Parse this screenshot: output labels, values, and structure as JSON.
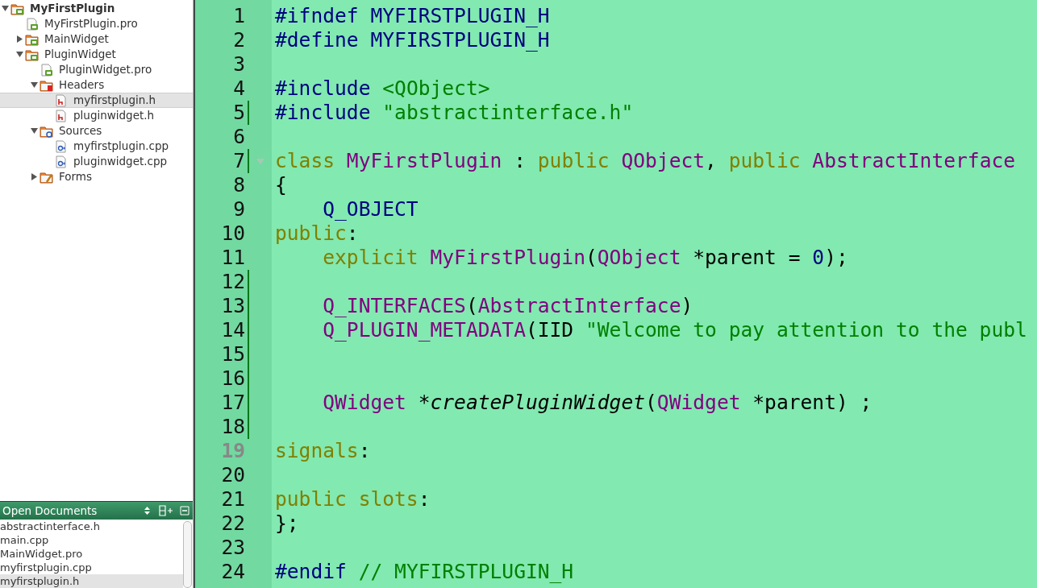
{
  "project_tree": [
    {
      "label": "MyFirstPlugin",
      "kind": "project",
      "expanded": true,
      "bold": true,
      "selected": false,
      "children": [
        {
          "label": "MyFirstPlugin.pro",
          "kind": "pro",
          "selected": false
        },
        {
          "label": "MainWidget",
          "kind": "project",
          "expanded": false,
          "selected": false
        },
        {
          "label": "PluginWidget",
          "kind": "project",
          "expanded": true,
          "selected": false,
          "children": [
            {
              "label": "PluginWidget.pro",
              "kind": "pro",
              "selected": false
            },
            {
              "label": "Headers",
              "kind": "headers",
              "expanded": true,
              "selected": false,
              "children": [
                {
                  "label": "myfirstplugin.h",
                  "kind": "header",
                  "selected": true
                },
                {
                  "label": "pluginwidget.h",
                  "kind": "header",
                  "selected": false
                }
              ]
            },
            {
              "label": "Sources",
              "kind": "sources",
              "expanded": true,
              "selected": false,
              "children": [
                {
                  "label": "myfirstplugin.cpp",
                  "kind": "source",
                  "selected": false
                },
                {
                  "label": "pluginwidget.cpp",
                  "kind": "source",
                  "selected": false
                }
              ]
            },
            {
              "label": "Forms",
              "kind": "forms",
              "expanded": false,
              "selected": false
            }
          ]
        }
      ]
    }
  ],
  "open_documents": {
    "title": "Open Documents",
    "items": [
      {
        "label": "abstractinterface.h",
        "selected": false
      },
      {
        "label": "main.cpp",
        "selected": false
      },
      {
        "label": "MainWidget.pro",
        "selected": false
      },
      {
        "label": "myfirstplugin.cpp",
        "selected": false
      },
      {
        "label": "myfirstplugin.h",
        "selected": true
      }
    ]
  },
  "editor": {
    "lines": [
      {
        "number": "1",
        "tokens": [
          {
            "kind": "preproc",
            "text": "#ifndef MYFIRSTPLUGIN_H"
          }
        ]
      },
      {
        "number": "2",
        "tokens": [
          {
            "kind": "preproc",
            "text": "#define MYFIRSTPLUGIN_H"
          }
        ]
      },
      {
        "number": "3"
      },
      {
        "number": "4",
        "tokens": [
          {
            "kind": "preproc",
            "text": "#include "
          },
          {
            "kind": "string",
            "text": "<QObject>"
          }
        ]
      },
      {
        "number": "5",
        "changed": true,
        "tokens": [
          {
            "kind": "preproc",
            "text": "#include "
          },
          {
            "kind": "string",
            "text": "\"abstractinterface.h\""
          }
        ]
      },
      {
        "number": "6"
      },
      {
        "number": "7",
        "changed": true,
        "foldable": true,
        "tokens": [
          {
            "kind": "keyword",
            "text": "class "
          },
          {
            "kind": "type",
            "text": "MyFirstPlugin"
          },
          {
            "kind": "plain",
            "text": " : "
          },
          {
            "kind": "keyword",
            "text": "public "
          },
          {
            "kind": "type",
            "text": "QObject"
          },
          {
            "kind": "plain",
            "text": ", "
          },
          {
            "kind": "keyword",
            "text": "public "
          },
          {
            "kind": "type",
            "text": "AbstractInterface"
          }
        ]
      },
      {
        "number": "8",
        "tokens": [
          {
            "kind": "plain",
            "text": "{"
          }
        ]
      },
      {
        "number": "9",
        "indented": true,
        "tokens": [
          {
            "kind": "preproc",
            "text": "Q_OBJECT"
          }
        ]
      },
      {
        "number": "10",
        "tokens": [
          {
            "kind": "keyword",
            "text": "public"
          },
          {
            "kind": "plain",
            "text": ":"
          }
        ]
      },
      {
        "number": "11",
        "indented": true,
        "tokens": [
          {
            "kind": "keyword",
            "text": "explicit "
          },
          {
            "kind": "type",
            "text": "MyFirstPlugin"
          },
          {
            "kind": "plain",
            "text": "("
          },
          {
            "kind": "type",
            "text": "QObject"
          },
          {
            "kind": "plain",
            "text": " *parent = "
          },
          {
            "kind": "number",
            "text": "0"
          },
          {
            "kind": "plain",
            "text": ");"
          }
        ]
      },
      {
        "number": "12",
        "changed": true
      },
      {
        "number": "13",
        "changed": true,
        "indented": true,
        "tokens": [
          {
            "kind": "type",
            "text": "Q_INTERFACES"
          },
          {
            "kind": "plain",
            "text": "("
          },
          {
            "kind": "type",
            "text": "AbstractInterface"
          },
          {
            "kind": "plain",
            "text": ")"
          }
        ]
      },
      {
        "number": "14",
        "changed": true,
        "indented": true,
        "tokens": [
          {
            "kind": "type",
            "text": "Q_PLUGIN_METADATA"
          },
          {
            "kind": "plain",
            "text": "(IID "
          },
          {
            "kind": "string",
            "text": "\"Welcome to pay attention to the publ"
          }
        ]
      },
      {
        "number": "15",
        "changed": true
      },
      {
        "number": "16",
        "changed": true
      },
      {
        "number": "17",
        "changed": true,
        "indented": true,
        "tokens": [
          {
            "kind": "type",
            "text": "QWidget"
          },
          {
            "kind": "plain",
            "text": " *"
          },
          {
            "kind": "function",
            "text": "createPluginWidget"
          },
          {
            "kind": "plain",
            "text": "("
          },
          {
            "kind": "type",
            "text": "QWidget"
          },
          {
            "kind": "plain",
            "text": " *parent) ;"
          }
        ]
      },
      {
        "number": "18",
        "changed": true
      },
      {
        "number": "19",
        "current": true,
        "tokens": [
          {
            "kind": "keyword",
            "text": "signals"
          },
          {
            "kind": "plain",
            "text": ":"
          }
        ]
      },
      {
        "number": "20"
      },
      {
        "number": "21",
        "tokens": [
          {
            "kind": "keyword",
            "text": "public slots"
          },
          {
            "kind": "plain",
            "text": ":"
          }
        ]
      },
      {
        "number": "22",
        "tokens": [
          {
            "kind": "plain",
            "text": "};"
          }
        ]
      },
      {
        "number": "23"
      },
      {
        "number": "24",
        "tokens": [
          {
            "kind": "preproc",
            "text": "#endif "
          },
          {
            "kind": "comment",
            "text": "// MYFIRSTPLUGIN_H"
          }
        ]
      }
    ]
  }
}
